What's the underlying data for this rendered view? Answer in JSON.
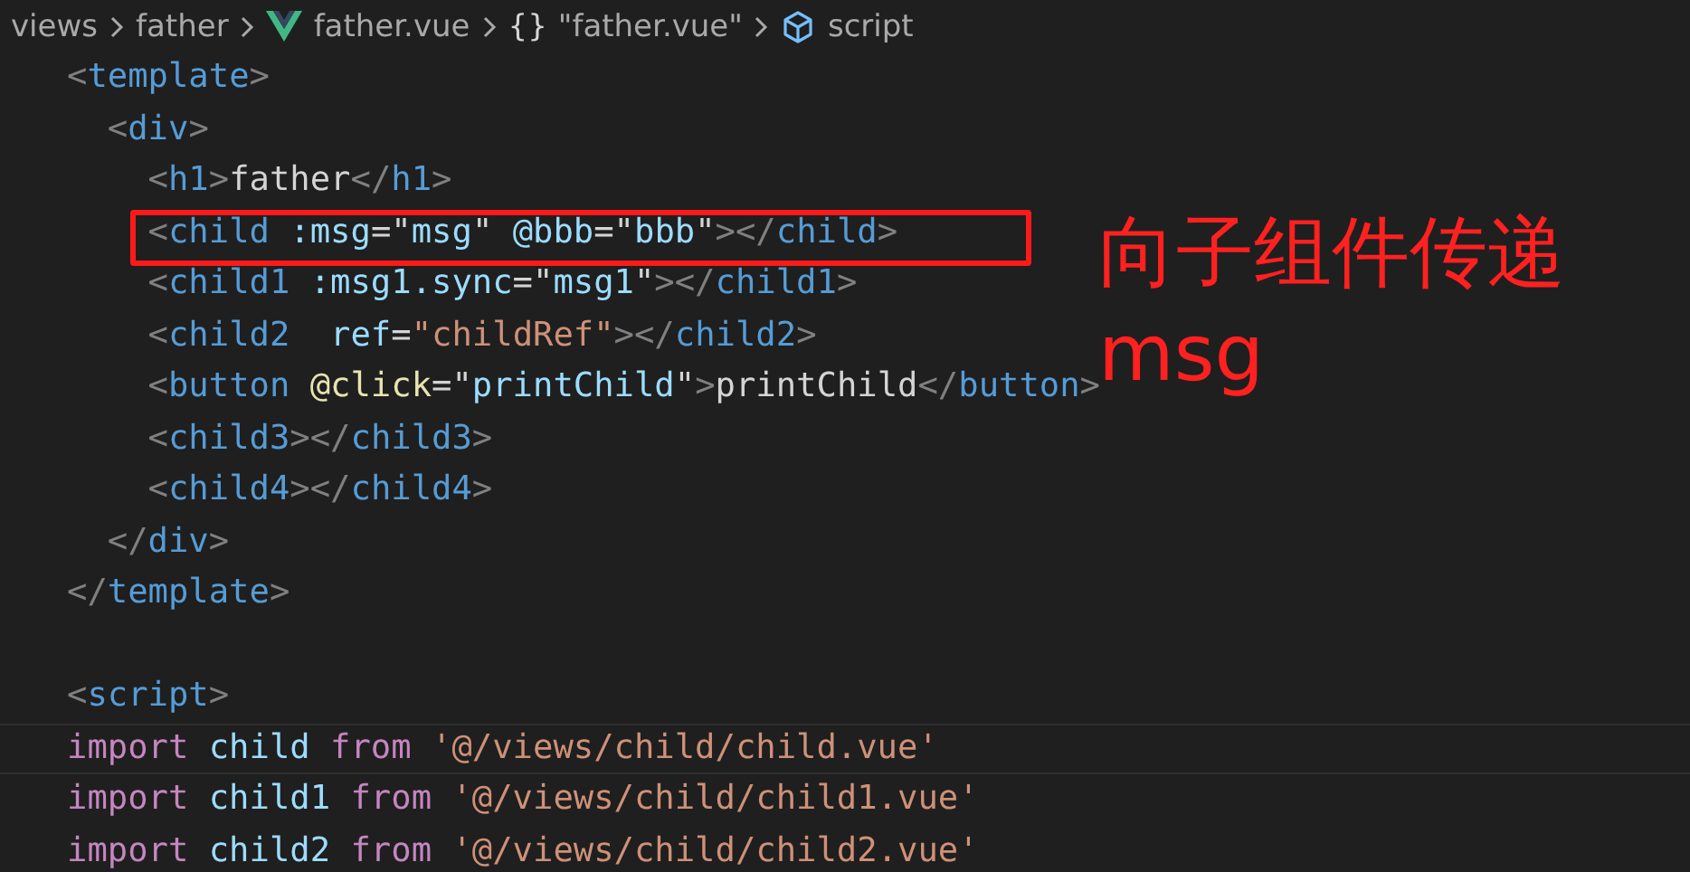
{
  "breadcrumb": [
    {
      "kind": "folder",
      "text": "views"
    },
    {
      "kind": "folder",
      "text": "father"
    },
    {
      "kind": "vue-file",
      "text": "father.vue"
    },
    {
      "kind": "object",
      "icon_text": "{}",
      "text": "\"father.vue\""
    },
    {
      "kind": "module",
      "text": "script"
    }
  ],
  "code_lines": [
    {
      "boxed": false,
      "current": false,
      "tokens": [
        {
          "kind": "p",
          "text": "<"
        },
        {
          "kind": "tag",
          "text": "template"
        },
        {
          "kind": "p",
          "text": ">"
        }
      ]
    },
    {
      "boxed": false,
      "current": false,
      "tokens": [
        {
          "kind": "p",
          "text": "  <"
        },
        {
          "kind": "tag",
          "text": "div"
        },
        {
          "kind": "p",
          "text": ">"
        }
      ]
    },
    {
      "boxed": false,
      "current": false,
      "tokens": [
        {
          "kind": "p",
          "text": "    <"
        },
        {
          "kind": "tag",
          "text": "h1"
        },
        {
          "kind": "p",
          "text": ">"
        },
        {
          "kind": "text",
          "text": "father"
        },
        {
          "kind": "p",
          "text": "</"
        },
        {
          "kind": "tag",
          "text": "h1"
        },
        {
          "kind": "p",
          "text": ">"
        }
      ]
    },
    {
      "boxed": true,
      "current": false,
      "tokens": [
        {
          "kind": "p",
          "text": "    <"
        },
        {
          "kind": "tag",
          "text": "child"
        },
        {
          "kind": "attr",
          "text": " :msg"
        },
        {
          "kind": "text",
          "text": "=\""
        },
        {
          "kind": "expr",
          "text": "msg"
        },
        {
          "kind": "text",
          "text": "\" "
        },
        {
          "kind": "attr",
          "text": "@bbb"
        },
        {
          "kind": "text",
          "text": "=\""
        },
        {
          "kind": "expr",
          "text": "bbb"
        },
        {
          "kind": "text",
          "text": "\""
        },
        {
          "kind": "p",
          "text": "></"
        },
        {
          "kind": "tag",
          "text": "child"
        },
        {
          "kind": "p",
          "text": ">"
        }
      ]
    },
    {
      "boxed": false,
      "current": false,
      "tokens": [
        {
          "kind": "p",
          "text": "    <"
        },
        {
          "kind": "tag",
          "text": "child1"
        },
        {
          "kind": "attr",
          "text": " :msg1.sync"
        },
        {
          "kind": "text",
          "text": "=\""
        },
        {
          "kind": "expr",
          "text": "msg1"
        },
        {
          "kind": "text",
          "text": "\""
        },
        {
          "kind": "p",
          "text": "></"
        },
        {
          "kind": "tag",
          "text": "child1"
        },
        {
          "kind": "p",
          "text": ">"
        }
      ]
    },
    {
      "boxed": false,
      "current": false,
      "tokens": [
        {
          "kind": "p",
          "text": "    <"
        },
        {
          "kind": "tag",
          "text": "child2"
        },
        {
          "kind": "attr",
          "text": "  ref"
        },
        {
          "kind": "text",
          "text": "="
        },
        {
          "kind": "str",
          "text": "\"childRef\""
        },
        {
          "kind": "p",
          "text": "></"
        },
        {
          "kind": "tag",
          "text": "child2"
        },
        {
          "kind": "p",
          "text": ">"
        }
      ]
    },
    {
      "boxed": false,
      "current": false,
      "tokens": [
        {
          "kind": "p",
          "text": "    <"
        },
        {
          "kind": "tag",
          "text": "button"
        },
        {
          "kind": "event",
          "text": " @click"
        },
        {
          "kind": "text",
          "text": "=\""
        },
        {
          "kind": "expr",
          "text": "printChild"
        },
        {
          "kind": "text",
          "text": "\""
        },
        {
          "kind": "p",
          "text": ">"
        },
        {
          "kind": "text",
          "text": "printChild"
        },
        {
          "kind": "p",
          "text": "</"
        },
        {
          "kind": "tag",
          "text": "button"
        },
        {
          "kind": "p",
          "text": ">"
        }
      ]
    },
    {
      "boxed": false,
      "current": false,
      "tokens": [
        {
          "kind": "p",
          "text": "    <"
        },
        {
          "kind": "tag",
          "text": "child3"
        },
        {
          "kind": "p",
          "text": "></"
        },
        {
          "kind": "tag",
          "text": "child3"
        },
        {
          "kind": "p",
          "text": ">"
        }
      ]
    },
    {
      "boxed": false,
      "current": false,
      "tokens": [
        {
          "kind": "p",
          "text": "    <"
        },
        {
          "kind": "tag",
          "text": "child4"
        },
        {
          "kind": "p",
          "text": "></"
        },
        {
          "kind": "tag",
          "text": "child4"
        },
        {
          "kind": "p",
          "text": ">"
        }
      ]
    },
    {
      "boxed": false,
      "current": false,
      "tokens": [
        {
          "kind": "p",
          "text": "  </"
        },
        {
          "kind": "tag",
          "text": "div"
        },
        {
          "kind": "p",
          "text": ">"
        }
      ]
    },
    {
      "boxed": false,
      "current": false,
      "tokens": [
        {
          "kind": "p",
          "text": "</"
        },
        {
          "kind": "tag",
          "text": "template"
        },
        {
          "kind": "p",
          "text": ">"
        }
      ]
    },
    {
      "boxed": false,
      "current": false
    },
    {
      "boxed": false,
      "current": false,
      "tokens": [
        {
          "kind": "p",
          "text": "<"
        },
        {
          "kind": "tag",
          "text": "script"
        },
        {
          "kind": "p",
          "text": ">"
        }
      ]
    },
    {
      "boxed": false,
      "current": true,
      "tokens": [
        {
          "kind": "kw",
          "text": "import"
        },
        {
          "kind": "id",
          "text": " child"
        },
        {
          "kind": "kw",
          "text": " from"
        },
        {
          "kind": "str",
          "text": " '@/views/child/child.vue'"
        }
      ]
    },
    {
      "boxed": false,
      "current": false,
      "tokens": [
        {
          "kind": "kw",
          "text": "import"
        },
        {
          "kind": "id",
          "text": " child1"
        },
        {
          "kind": "kw",
          "text": " from"
        },
        {
          "kind": "str",
          "text": " '@/views/child/child1.vue'"
        }
      ]
    },
    {
      "boxed": false,
      "current": false,
      "tokens": [
        {
          "kind": "kw",
          "text": "import"
        },
        {
          "kind": "id",
          "text": " child2"
        },
        {
          "kind": "kw",
          "text": " from"
        },
        {
          "kind": "str",
          "text": " '@/views/child/child2.vue'"
        }
      ]
    }
  ],
  "annotation": {
    "text": "向子组件传递msg"
  }
}
